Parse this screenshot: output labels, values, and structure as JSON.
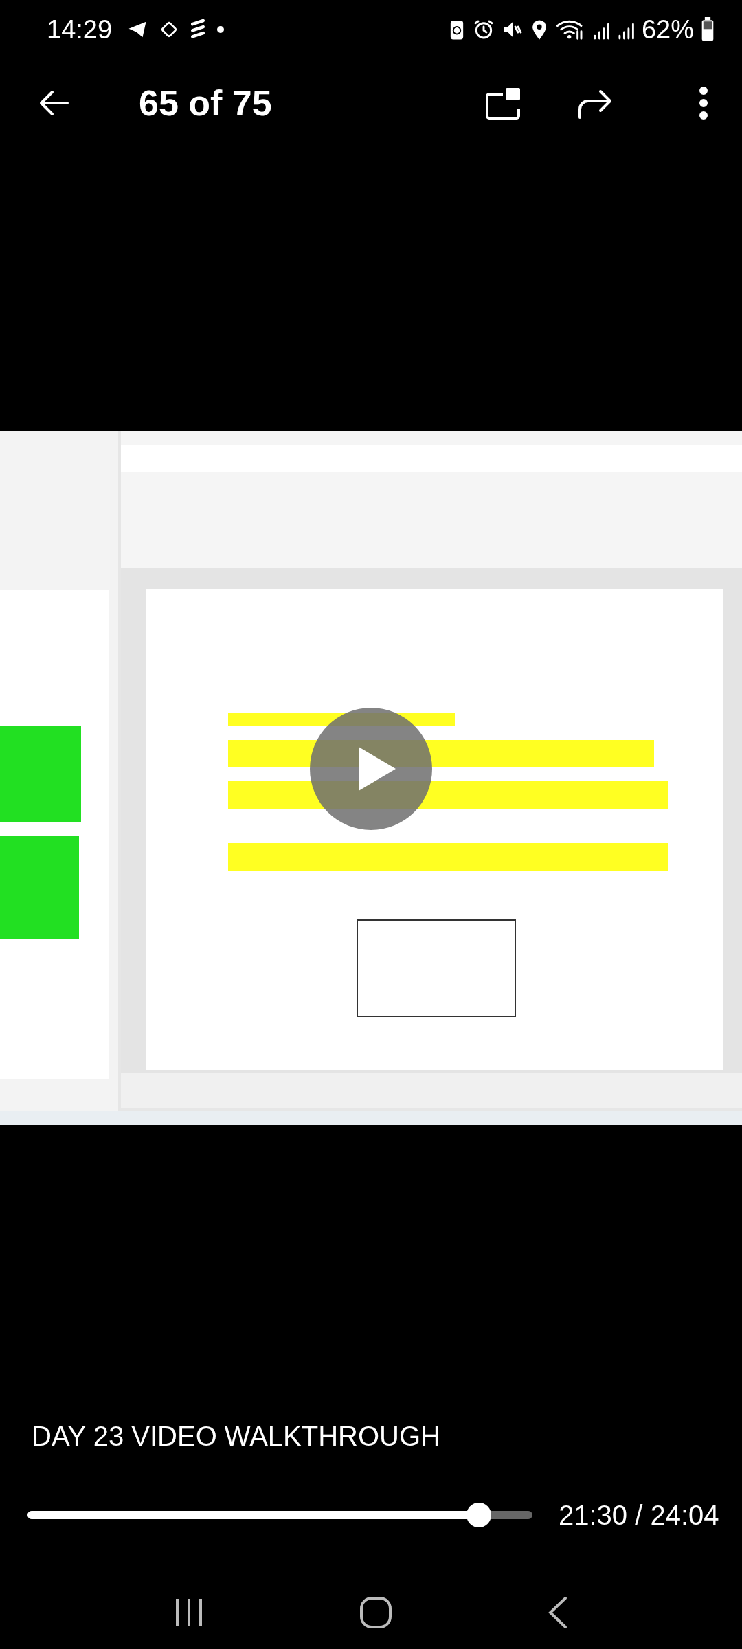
{
  "status_bar": {
    "time": "14:29",
    "battery": "62%"
  },
  "app_bar": {
    "title": "65 of 75"
  },
  "video": {
    "kind": "picture",
    "paused": true
  },
  "caption": "DAY 23 VIDEO WALKTHROUGH",
  "seek_bar": {
    "level": 0.894,
    "time": "21:30 / 24:04"
  }
}
